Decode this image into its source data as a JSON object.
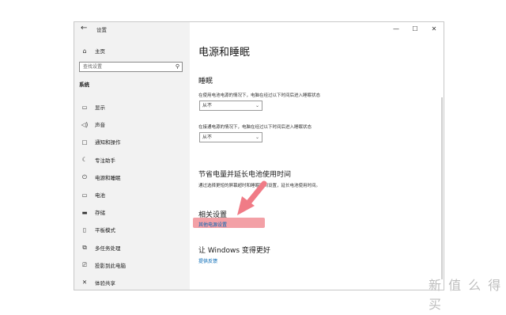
{
  "window": {
    "title": "设置",
    "back_icon": "arrow-left-icon",
    "controls": [
      "—",
      "☐",
      "✕"
    ]
  },
  "sidebar": {
    "home_label": "主页",
    "search_placeholder": "查找设置",
    "section": "系统",
    "items": [
      {
        "label": "显示",
        "icon": "monitor-icon"
      },
      {
        "label": "声音",
        "icon": "speaker-icon"
      },
      {
        "label": "通知和操作",
        "icon": "notification-icon"
      },
      {
        "label": "专注助手",
        "icon": "moon-icon"
      },
      {
        "label": "电源和睡眠",
        "icon": "power-icon"
      },
      {
        "label": "电池",
        "icon": "battery-icon"
      },
      {
        "label": "存储",
        "icon": "storage-icon"
      },
      {
        "label": "平板模式",
        "icon": "tablet-icon"
      },
      {
        "label": "多任务处理",
        "icon": "multitask-icon"
      },
      {
        "label": "投影到此电脑",
        "icon": "project-icon"
      },
      {
        "label": "体验共享",
        "icon": "share-icon"
      }
    ]
  },
  "main": {
    "title": "电源和睡眠",
    "sleep_heading": "睡眠",
    "battery_desc": "在使用电池电源的情况下，电脑在经过以下时间后进入睡眠状态",
    "battery_value": "从不",
    "plugged_desc": "在接通电源的情况下，电脑在经过以下时间后进入睡眠状态",
    "plugged_value": "从不",
    "save_heading": "节省电量并延长电池使用时间",
    "save_desc": "通过选择更短的屏幕超时和睡眠时间设置，延长电池使用时间。",
    "related_heading": "相关设置",
    "related_link": "其他电源设置",
    "better_heading": "让 Windows 变得更好",
    "feedback_link": "提供反馈"
  },
  "watermark": "新 值 么 得 买",
  "colors": {
    "link": "#0066b4",
    "highlight": "#f3a0a6",
    "arrow": "#f07b86"
  }
}
